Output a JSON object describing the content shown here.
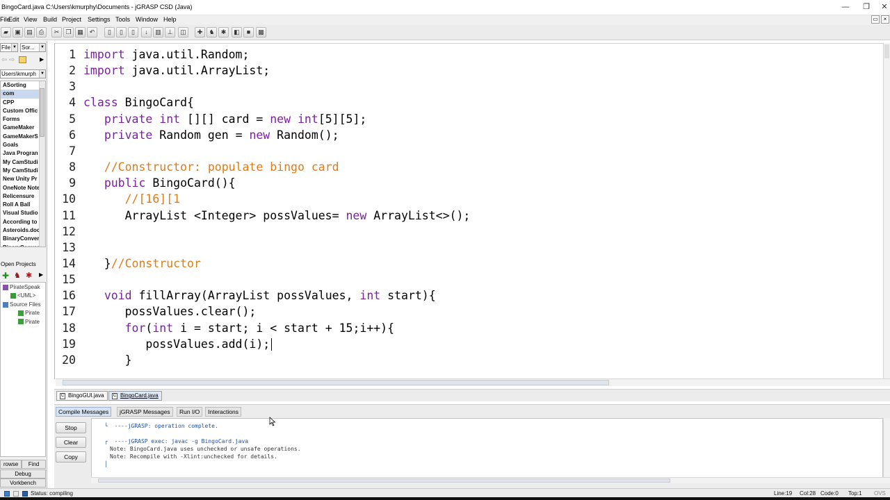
{
  "window": {
    "title": "BingoCard.java  C:\\Users\\kmurphy\\Documents - jGRASP CSD (Java)",
    "controls": [
      "—",
      "❐",
      "✕"
    ]
  },
  "menu": {
    "items": [
      "File",
      "Edit",
      "View",
      "Build",
      "Project",
      "Settings",
      "Tools",
      "Window",
      "Help"
    ]
  },
  "left": {
    "file_combo": "File",
    "sort_combo": "Sor...",
    "path_combo": "Users\\kmurph",
    "files": [
      "ASorting",
      "com",
      "CPP",
      "Custom Offic",
      "Forms",
      "GameMaker",
      "GameMakerS",
      "Goals",
      "Java Progran",
      "My CamStudi",
      "My CamStudi",
      "New Unity Pr",
      "OneNote Note",
      "Relicensure",
      "Roll A Ball",
      "Visual Studio",
      "According to",
      "Asteroids.doc",
      "BinaryConver",
      "BinaryConver"
    ],
    "selected_index": 1,
    "open_projects_label": "Open Projects",
    "tree": [
      {
        "label": "PirateSpeak",
        "indent": 0,
        "icon": "project-icon"
      },
      {
        "label": "<UML>",
        "indent": 1,
        "icon": "uml-icon"
      },
      {
        "label": "Source Files",
        "indent": 0,
        "icon": "folder-icon"
      },
      {
        "label": "Pirate",
        "indent": 2,
        "icon": "java-file-icon"
      },
      {
        "label": "Pirate",
        "indent": 2,
        "icon": "java-file-icon"
      }
    ],
    "tabs": {
      "browse": "rowse",
      "find": "Find",
      "debug": "Debug",
      "workbench": "Vorkbench"
    }
  },
  "editor": {
    "lines": [
      {
        "n": "1",
        "parts": [
          [
            "kw",
            "import"
          ],
          [
            "",
            " java.util.Random;"
          ]
        ]
      },
      {
        "n": "2",
        "parts": [
          [
            "kw",
            "import"
          ],
          [
            "",
            " java.util.ArrayList;"
          ]
        ]
      },
      {
        "n": "3",
        "parts": []
      },
      {
        "n": "4",
        "parts": [
          [
            "kw",
            "class"
          ],
          [
            "",
            " BingoCard{"
          ]
        ]
      },
      {
        "n": "5",
        "parts": [
          [
            "",
            "   "
          ],
          [
            "kw",
            "private"
          ],
          [
            "",
            " "
          ],
          [
            "kw",
            "int"
          ],
          [
            "",
            " [][] card = "
          ],
          [
            "kw",
            "new"
          ],
          [
            "",
            " "
          ],
          [
            "kw",
            "int"
          ],
          [
            "",
            "[5][5];"
          ]
        ]
      },
      {
        "n": "6",
        "parts": [
          [
            "",
            "   "
          ],
          [
            "kw",
            "private"
          ],
          [
            "",
            " Random gen = "
          ],
          [
            "kw",
            "new"
          ],
          [
            "",
            " Random();"
          ]
        ]
      },
      {
        "n": "7",
        "parts": []
      },
      {
        "n": "8",
        "parts": [
          [
            "",
            "   "
          ],
          [
            "cm",
            "//Constructor: populate bingo card"
          ]
        ]
      },
      {
        "n": "9",
        "parts": [
          [
            "",
            "   "
          ],
          [
            "kw",
            "public"
          ],
          [
            "",
            " BingoCard(){"
          ]
        ]
      },
      {
        "n": "10",
        "parts": [
          [
            "",
            "      "
          ],
          [
            "cm",
            "//[16][1"
          ]
        ]
      },
      {
        "n": "11",
        "parts": [
          [
            "",
            "      ArrayList <Integer> possValues= "
          ],
          [
            "kw",
            "new"
          ],
          [
            "",
            " ArrayList<>();"
          ]
        ]
      },
      {
        "n": "12",
        "parts": []
      },
      {
        "n": "13",
        "parts": []
      },
      {
        "n": "14",
        "parts": [
          [
            "",
            "   }"
          ],
          [
            "cm",
            "//Constructor"
          ]
        ]
      },
      {
        "n": "15",
        "parts": []
      },
      {
        "n": "16",
        "parts": [
          [
            "",
            "   "
          ],
          [
            "kw",
            "void"
          ],
          [
            "",
            " fillArray(ArrayList possValues, "
          ],
          [
            "kw",
            "int"
          ],
          [
            "",
            " start){"
          ]
        ]
      },
      {
        "n": "17",
        "parts": [
          [
            "",
            "      possValues.clear();"
          ]
        ]
      },
      {
        "n": "18",
        "parts": [
          [
            "",
            "      "
          ],
          [
            "kw",
            "for"
          ],
          [
            "",
            "("
          ],
          [
            "kw",
            "int"
          ],
          [
            "",
            " i = start; i < start + 15;i++){"
          ]
        ]
      },
      {
        "n": "19",
        "parts": [
          [
            "",
            "         possValues.add(i);"
          ]
        ],
        "caret": true
      },
      {
        "n": "20",
        "parts": [
          [
            "",
            "      }"
          ]
        ]
      }
    ]
  },
  "file_tabs": [
    {
      "label": "BingoGUI.java",
      "active": false
    },
    {
      "label": "BingoCard.java",
      "active": true
    }
  ],
  "messages": {
    "tabs": [
      "Compile Messages",
      "jGRASP Messages",
      "Run I/O",
      "Interactions"
    ],
    "active_tab": 0,
    "buttons": [
      "Stop",
      "Clear",
      "Copy"
    ],
    "lines": [
      {
        "text": "└  ----jGRASP: operation complete.",
        "style": "blue"
      },
      {
        "text": "",
        "style": ""
      },
      {
        "text": "┌  ----jGRASP exec: javac -g BingoCard.java",
        "style": "blue"
      },
      {
        "text": "Note: BingoCard.java uses unchecked or unsafe operations.",
        "style": ""
      },
      {
        "text": "Note: Recompile with -Xlint:unchecked for details.",
        "style": ""
      },
      {
        "text": "│",
        "style": "blue"
      }
    ]
  },
  "status": {
    "text": "Status: compiling",
    "line": "Line:19",
    "col": "Col:28",
    "code": "Code:0",
    "top": "Top:1",
    "mode": "OVS"
  },
  "colors": {
    "keyword": "#7b1fa2",
    "comment": "#e07b14",
    "selection": "#c9d8ef"
  }
}
